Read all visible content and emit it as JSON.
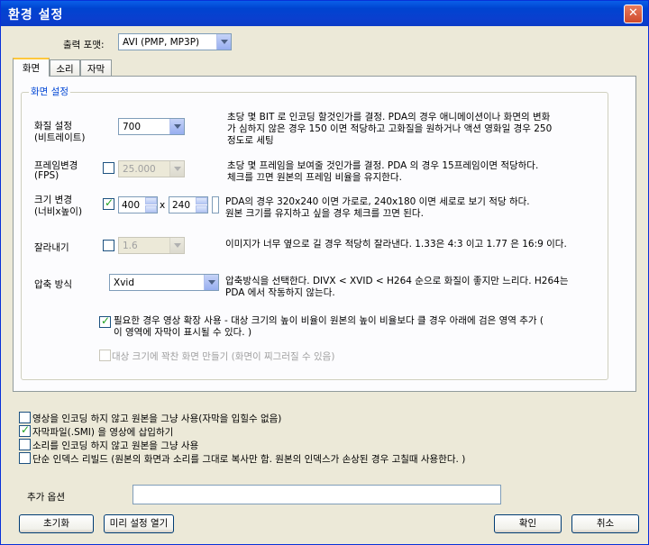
{
  "window": {
    "title": "환경 설정",
    "close_label": "✕"
  },
  "output_format": {
    "label": "출력 포맷:",
    "value": "AVI (PMP, MP3P)"
  },
  "tabs": [
    {
      "label": "화면"
    },
    {
      "label": "소리"
    },
    {
      "label": "자막"
    }
  ],
  "screen_group": {
    "title": "화면 설정",
    "quality": {
      "label1": "화질 설정",
      "label2": "(비트레이트)",
      "value": "700",
      "desc": [
        "초당 몇 BIT 로 인코딩 할것인가를 결정. PDA의 경우 애니메이션이나 화면의 변화",
        "가 심하지 않은 경우 150 이면 적당하고 고화질을 원하거나 액션 영화일 경우  250",
        "정도로 세팅"
      ]
    },
    "frame": {
      "label1": "프레임변경",
      "label2": "(FPS)",
      "value": "25.000",
      "desc": [
        "초당 몇 프레임을 보여줄 것인가를 결정. PDA 의 경우 15프레임이면 적당하다.",
        "체크를 끄면 원본의 프레임 비율을 유지한다."
      ]
    },
    "size": {
      "label1": "크기 변경",
      "label2": "(너비x높이)",
      "width": "400",
      "x": "x",
      "height": "240",
      "desc": [
        "PDA의 경우 320x240 이면 가로로, 240x180 이면 세로로 보기 적당 하다.",
        "원본 크기를 유지하고 싶을 경우 체크를 끄면 된다."
      ]
    },
    "crop": {
      "label": "잘라내기",
      "value": "1.6",
      "desc": "이미지가 너무 옆으로 길 경우 적당히 잘라낸다. 1.33은 4:3 이고 1.77 은 16:9 이다."
    },
    "codec": {
      "label": "압축 방식",
      "value": "Xvid",
      "desc": [
        "압축방식을 선택한다.  DIVX < XVID < H264 순으로 화질이 좋지만 느리다. H264는",
        "PDA 에서 작동하지 않는다."
      ]
    },
    "expand": [
      "필요한 경우 영상 확장 사용 - 대상 크기의 높이 비율이 원본의 높이 비율보다 클 경우 아래에 검은  영역 추가 (",
      "이 영역에 자막이 표시될 수 있다. )"
    ],
    "fill": "대상 크기에 꽉찬 화면 만들기 (화면이 찌그러질 수 있음)"
  },
  "options": {
    "no_encode_video": "영상을 인코딩 하지 않고 원본을 그냥 사용(자막을 입힐수 없음)",
    "insert_subtitle": "자막파일(.SMI) 을 영상에 삽입하기",
    "no_encode_audio": "소리를 인코딩 하지 않고 원본을 그냥 사용",
    "index_rebuild": "단순 인덱스 리빌드 (원본의 화면과 소리를 그대로 복사만 함. 원본의 인덱스가 손상된 경우 고칠때 사용한다. )"
  },
  "extra": {
    "label": "추가 옵션",
    "value": ""
  },
  "buttons": {
    "reset": "초기화",
    "preset": "미리 설정 열기",
    "ok": "확인",
    "cancel": "취소"
  }
}
